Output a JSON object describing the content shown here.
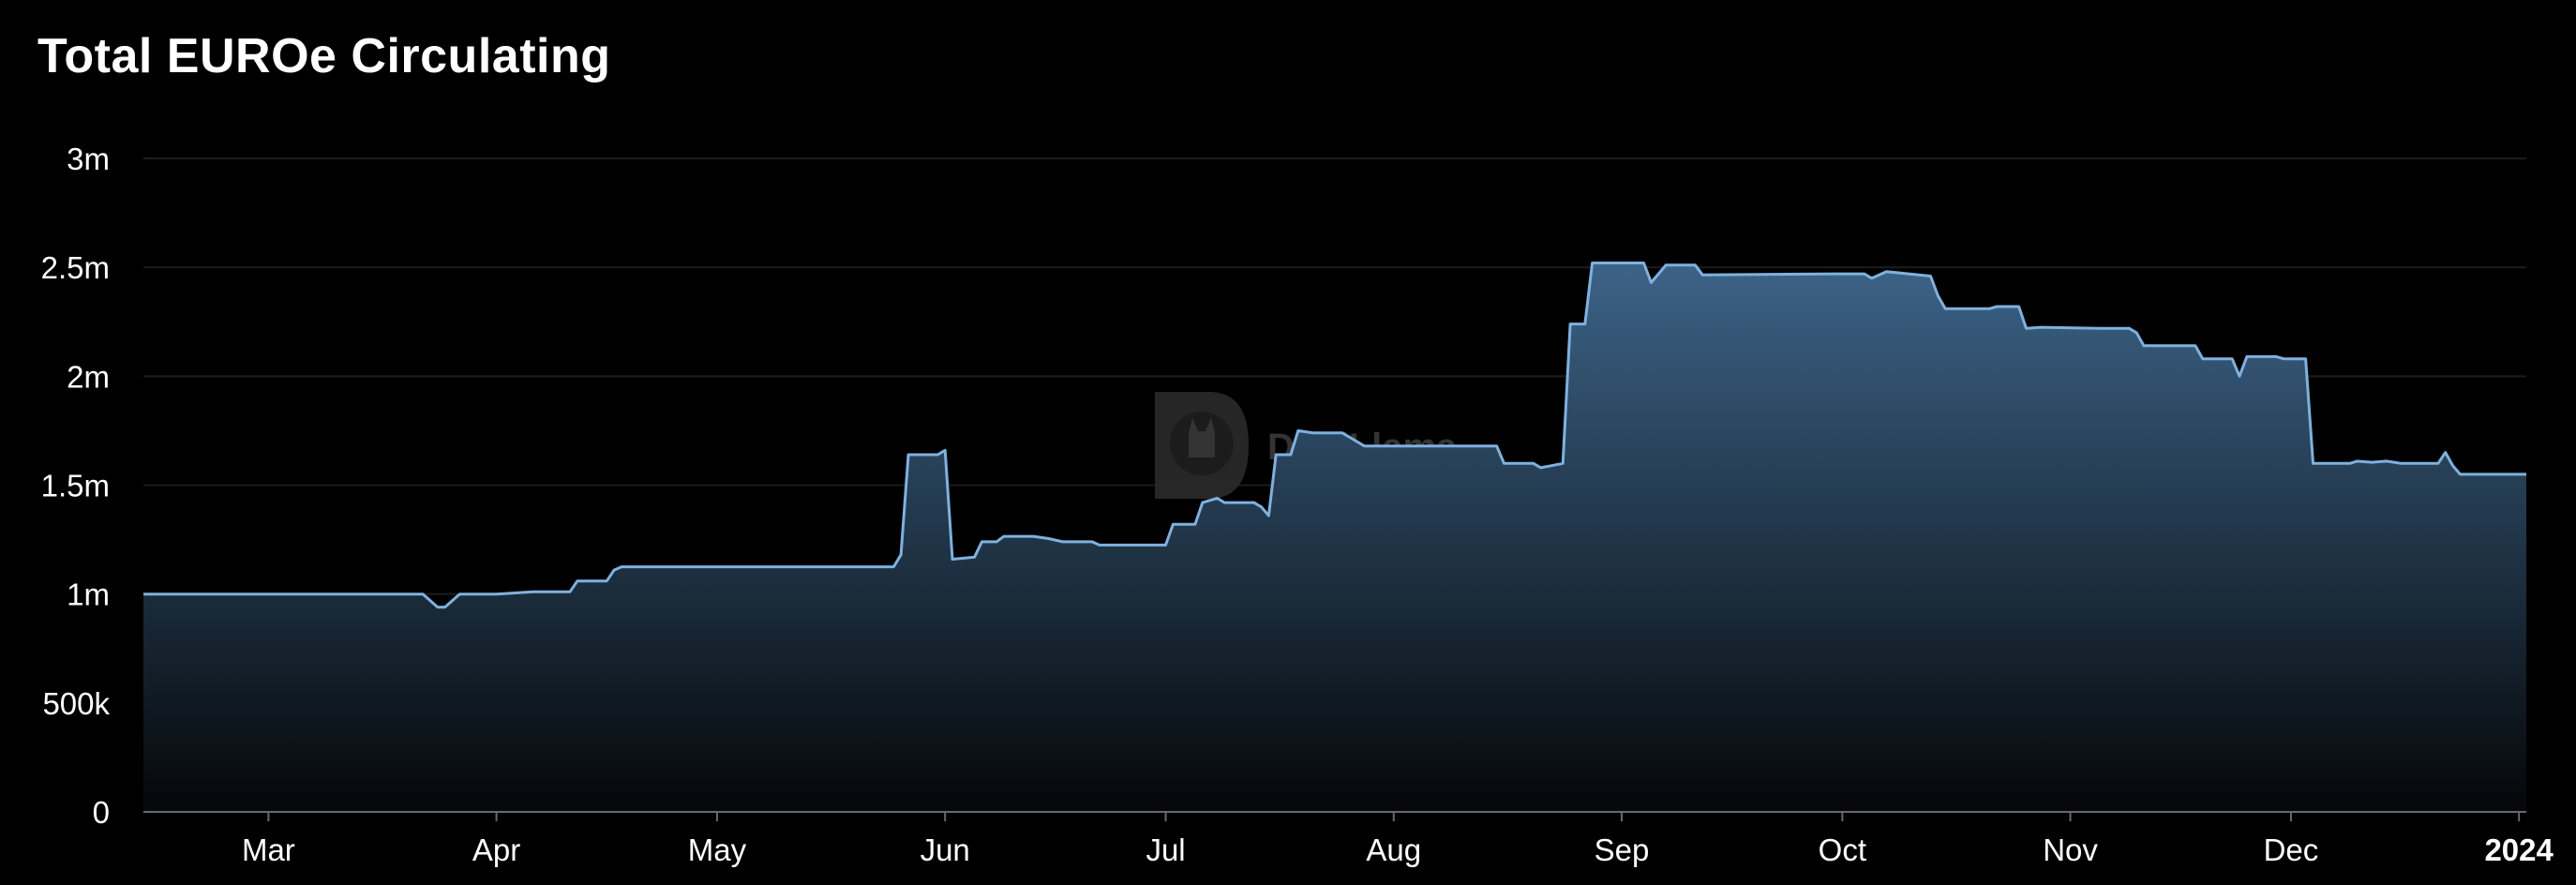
{
  "chart_data": {
    "type": "area",
    "title": "Total EUROe Circulating",
    "xlabel": "",
    "ylabel": "",
    "ylim": [
      0,
      3000000
    ],
    "yticks": [
      {
        "value": 0,
        "label": "0"
      },
      {
        "value": 500000,
        "label": "500k"
      },
      {
        "value": 1000000,
        "label": "1m"
      },
      {
        "value": 1500000,
        "label": "1.5m"
      },
      {
        "value": 2000000,
        "label": "2m"
      },
      {
        "value": 2500000,
        "label": "2.5m"
      },
      {
        "value": 3000000,
        "label": "3m"
      }
    ],
    "xlim": [
      "2023-02-12",
      "2024-01-02"
    ],
    "xticks": [
      {
        "date": "2023-03-01",
        "label": "Mar",
        "bold": false
      },
      {
        "date": "2023-04-01",
        "label": "Apr",
        "bold": false
      },
      {
        "date": "2023-05-01",
        "label": "May",
        "bold": false
      },
      {
        "date": "2023-06-01",
        "label": "Jun",
        "bold": false
      },
      {
        "date": "2023-07-01",
        "label": "Jul",
        "bold": false
      },
      {
        "date": "2023-08-01",
        "label": "Aug",
        "bold": false
      },
      {
        "date": "2023-09-01",
        "label": "Sep",
        "bold": false
      },
      {
        "date": "2023-10-01",
        "label": "Oct",
        "bold": false
      },
      {
        "date": "2023-11-01",
        "label": "Nov",
        "bold": false
      },
      {
        "date": "2023-12-01",
        "label": "Dec",
        "bold": false
      },
      {
        "date": "2024-01-01",
        "label": "2024",
        "bold": true
      }
    ],
    "grid": true,
    "series": [
      {
        "name": "EUROe",
        "points": [
          [
            "2023-02-12",
            1000000
          ],
          [
            "2023-03-22",
            1000000
          ],
          [
            "2023-03-24",
            940000
          ],
          [
            "2023-03-25",
            940000
          ],
          [
            "2023-03-27",
            1000000
          ],
          [
            "2023-04-01",
            1000000
          ],
          [
            "2023-04-06",
            1010000
          ],
          [
            "2023-04-07",
            1010000
          ],
          [
            "2023-04-11",
            1010000
          ],
          [
            "2023-04-12",
            1060000
          ],
          [
            "2023-04-16",
            1060000
          ],
          [
            "2023-04-17",
            1110000
          ],
          [
            "2023-04-18",
            1125000
          ],
          [
            "2023-05-01",
            1125000
          ],
          [
            "2023-05-25",
            1125000
          ],
          [
            "2023-05-26",
            1180000
          ],
          [
            "2023-05-27",
            1640000
          ],
          [
            "2023-05-31",
            1640000
          ],
          [
            "2023-06-01",
            1660000
          ],
          [
            "2023-06-02",
            1160000
          ],
          [
            "2023-06-05",
            1170000
          ],
          [
            "2023-06-06",
            1240000
          ],
          [
            "2023-06-08",
            1240000
          ],
          [
            "2023-06-09",
            1265000
          ],
          [
            "2023-06-13",
            1265000
          ],
          [
            "2023-06-15",
            1255000
          ],
          [
            "2023-06-17",
            1240000
          ],
          [
            "2023-06-21",
            1240000
          ],
          [
            "2023-06-22",
            1225000
          ],
          [
            "2023-06-30",
            1225000
          ],
          [
            "2023-07-01",
            1225000
          ],
          [
            "2023-07-02",
            1320000
          ],
          [
            "2023-07-05",
            1320000
          ],
          [
            "2023-07-06",
            1420000
          ],
          [
            "2023-07-08",
            1440000
          ],
          [
            "2023-07-09",
            1420000
          ],
          [
            "2023-07-13",
            1420000
          ],
          [
            "2023-07-14",
            1400000
          ],
          [
            "2023-07-15",
            1360000
          ],
          [
            "2023-07-16",
            1640000
          ],
          [
            "2023-07-18",
            1640000
          ],
          [
            "2023-07-19",
            1750000
          ],
          [
            "2023-07-21",
            1740000
          ],
          [
            "2023-07-25",
            1740000
          ],
          [
            "2023-07-27",
            1700000
          ],
          [
            "2023-07-28",
            1680000
          ],
          [
            "2023-08-12",
            1680000
          ],
          [
            "2023-08-15",
            1680000
          ],
          [
            "2023-08-16",
            1600000
          ],
          [
            "2023-08-20",
            1600000
          ],
          [
            "2023-08-21",
            1580000
          ],
          [
            "2023-08-24",
            1600000
          ],
          [
            "2023-08-25",
            2240000
          ],
          [
            "2023-08-27",
            2240000
          ],
          [
            "2023-08-28",
            2520000
          ],
          [
            "2023-09-04",
            2520000
          ],
          [
            "2023-09-05",
            2430000
          ],
          [
            "2023-09-07",
            2510000
          ],
          [
            "2023-09-11",
            2510000
          ],
          [
            "2023-09-12",
            2465000
          ],
          [
            "2023-09-30",
            2470000
          ],
          [
            "2023-10-04",
            2470000
          ],
          [
            "2023-10-05",
            2450000
          ],
          [
            "2023-10-07",
            2480000
          ],
          [
            "2023-10-10",
            2470000
          ],
          [
            "2023-10-13",
            2460000
          ],
          [
            "2023-10-14",
            2370000
          ],
          [
            "2023-10-15",
            2310000
          ],
          [
            "2023-10-21",
            2310000
          ],
          [
            "2023-10-22",
            2320000
          ],
          [
            "2023-10-25",
            2320000
          ],
          [
            "2023-10-26",
            2220000
          ],
          [
            "2023-10-28",
            2225000
          ],
          [
            "2023-11-05",
            2220000
          ],
          [
            "2023-11-09",
            2220000
          ],
          [
            "2023-11-10",
            2200000
          ],
          [
            "2023-11-11",
            2140000
          ],
          [
            "2023-11-18",
            2140000
          ],
          [
            "2023-11-19",
            2080000
          ],
          [
            "2023-11-23",
            2080000
          ],
          [
            "2023-11-24",
            2000000
          ],
          [
            "2023-11-25",
            2090000
          ],
          [
            "2023-11-29",
            2090000
          ],
          [
            "2023-11-30",
            2080000
          ],
          [
            "2023-12-03",
            2080000
          ],
          [
            "2023-12-04",
            1600000
          ],
          [
            "2023-12-09",
            1600000
          ],
          [
            "2023-12-10",
            1610000
          ],
          [
            "2023-12-12",
            1605000
          ],
          [
            "2023-12-14",
            1610000
          ],
          [
            "2023-12-16",
            1600000
          ],
          [
            "2023-12-21",
            1600000
          ],
          [
            "2023-12-22",
            1650000
          ],
          [
            "2023-12-23",
            1590000
          ],
          [
            "2023-12-24",
            1550000
          ],
          [
            "2024-01-02",
            1550000
          ]
        ]
      }
    ],
    "colors": {
      "line": "#7fb1de",
      "fill_top": "#3c6387",
      "fill_bottom": "#050709",
      "grid": "#1c1c1c",
      "axis": "#6a6a6a",
      "text": "#ffffff",
      "watermark": "#3a3a3a"
    },
    "watermark": {
      "text": "DeFiLlama",
      "icon": "llama-logo-icon"
    }
  }
}
